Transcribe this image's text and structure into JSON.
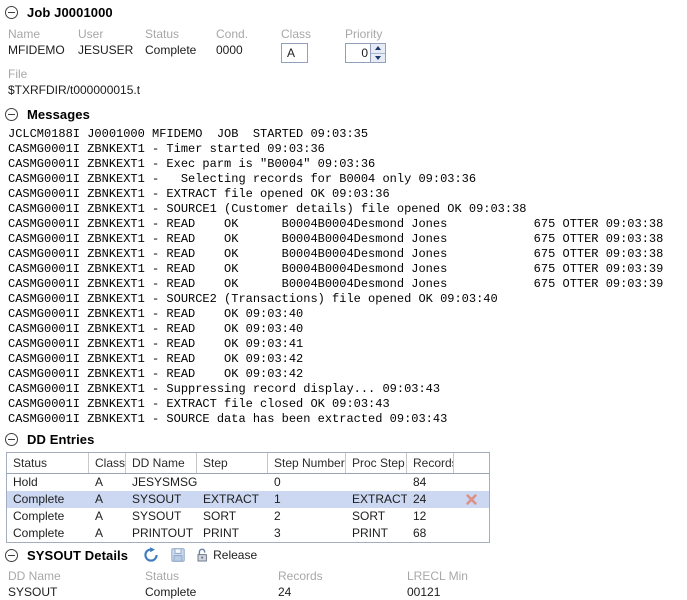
{
  "job": {
    "title": "Job J0001000",
    "fields": {
      "name_label": "Name",
      "name": "MFIDEMO",
      "user_label": "User",
      "user": "JESUSER",
      "status_label": "Status",
      "status": "Complete",
      "cond_label": "Cond.",
      "cond": "0000",
      "class_label": "Class",
      "class_value": "A",
      "priority_label": "Priority",
      "priority": "0",
      "file_label": "File",
      "file": "$TXRFDIR/t000000015.t"
    }
  },
  "messages": {
    "title": "Messages",
    "lines": [
      "JCLCM0188I J0001000 MFIDEMO  JOB  STARTED 09:03:35",
      "CASMG0001I ZBNKEXT1 - Timer started 09:03:36",
      "CASMG0001I ZBNKEXT1 - Exec parm is \"B0004\" 09:03:36",
      "CASMG0001I ZBNKEXT1 -   Selecting records for B0004 only 09:03:36",
      "CASMG0001I ZBNKEXT1 - EXTRACT file opened OK 09:03:36",
      "CASMG0001I ZBNKEXT1 - SOURCE1 (Customer details) file opened OK 09:03:38",
      "CASMG0001I ZBNKEXT1 - READ    OK      B0004B0004Desmond Jones            675 OTTER 09:03:38",
      "CASMG0001I ZBNKEXT1 - READ    OK      B0004B0004Desmond Jones            675 OTTER 09:03:38",
      "CASMG0001I ZBNKEXT1 - READ    OK      B0004B0004Desmond Jones            675 OTTER 09:03:38",
      "CASMG0001I ZBNKEXT1 - READ    OK      B0004B0004Desmond Jones            675 OTTER 09:03:39",
      "CASMG0001I ZBNKEXT1 - READ    OK      B0004B0004Desmond Jones            675 OTTER 09:03:39",
      "CASMG0001I ZBNKEXT1 - SOURCE2 (Transactions) file opened OK 09:03:40",
      "CASMG0001I ZBNKEXT1 - READ    OK 09:03:40",
      "CASMG0001I ZBNKEXT1 - READ    OK 09:03:40",
      "CASMG0001I ZBNKEXT1 - READ    OK 09:03:41",
      "CASMG0001I ZBNKEXT1 - READ    OK 09:03:42",
      "CASMG0001I ZBNKEXT1 - READ    OK 09:03:42",
      "CASMG0001I ZBNKEXT1 - Suppressing record display... 09:03:43",
      "CASMG0001I ZBNKEXT1 - EXTRACT file closed OK 09:03:43",
      "CASMG0001I ZBNKEXT1 - SOURCE data has been extracted 09:03:43"
    ]
  },
  "dd_entries": {
    "title": "DD Entries",
    "columns": [
      "Status",
      "Class",
      "DD Name",
      "Step",
      "Step Number",
      "Proc Step",
      "Records",
      ""
    ],
    "rows": [
      {
        "status": "Hold",
        "class": "A",
        "dd_name": "JESYSMSG",
        "step": "",
        "step_number": "0",
        "proc_step": "",
        "records": "84"
      },
      {
        "status": "Complete",
        "class": "A",
        "dd_name": "SYSOUT",
        "step": "EXTRACT",
        "step_number": "1",
        "proc_step": "EXTRACT",
        "records": "24"
      },
      {
        "status": "Complete",
        "class": "A",
        "dd_name": "SYSOUT",
        "step": "SORT",
        "step_number": "2",
        "proc_step": "SORT",
        "records": "12"
      },
      {
        "status": "Complete",
        "class": "A",
        "dd_name": "PRINTOUT",
        "step": "PRINT",
        "step_number": "3",
        "proc_step": "PRINT",
        "records": "68"
      }
    ],
    "selected_row_index": 1
  },
  "sysout_details": {
    "title": "SYSOUT Details",
    "release_label": "Release",
    "fields": {
      "dd_name_label": "DD Name",
      "dd_name": "SYSOUT",
      "status_label": "Status",
      "status": "Complete",
      "records_label": "Records",
      "records": "24",
      "lrecl_min_label": "LRECL Min",
      "lrecl_min": "00121"
    }
  },
  "icons": {
    "collapse": "minus-circle",
    "refresh": "refresh-circular-arrow",
    "save": "floppy-disk",
    "release": "open-padlock",
    "delete": "x-cross",
    "spinner_up": "up-triangle",
    "spinner_down": "down-triangle"
  },
  "colors": {
    "selected_row": "#ccd8f2",
    "label_gray": "#a8a8a8",
    "refresh_blue": "#3f7bbf",
    "delete_x": "#dc9186",
    "table_border": "#a3adbd"
  }
}
